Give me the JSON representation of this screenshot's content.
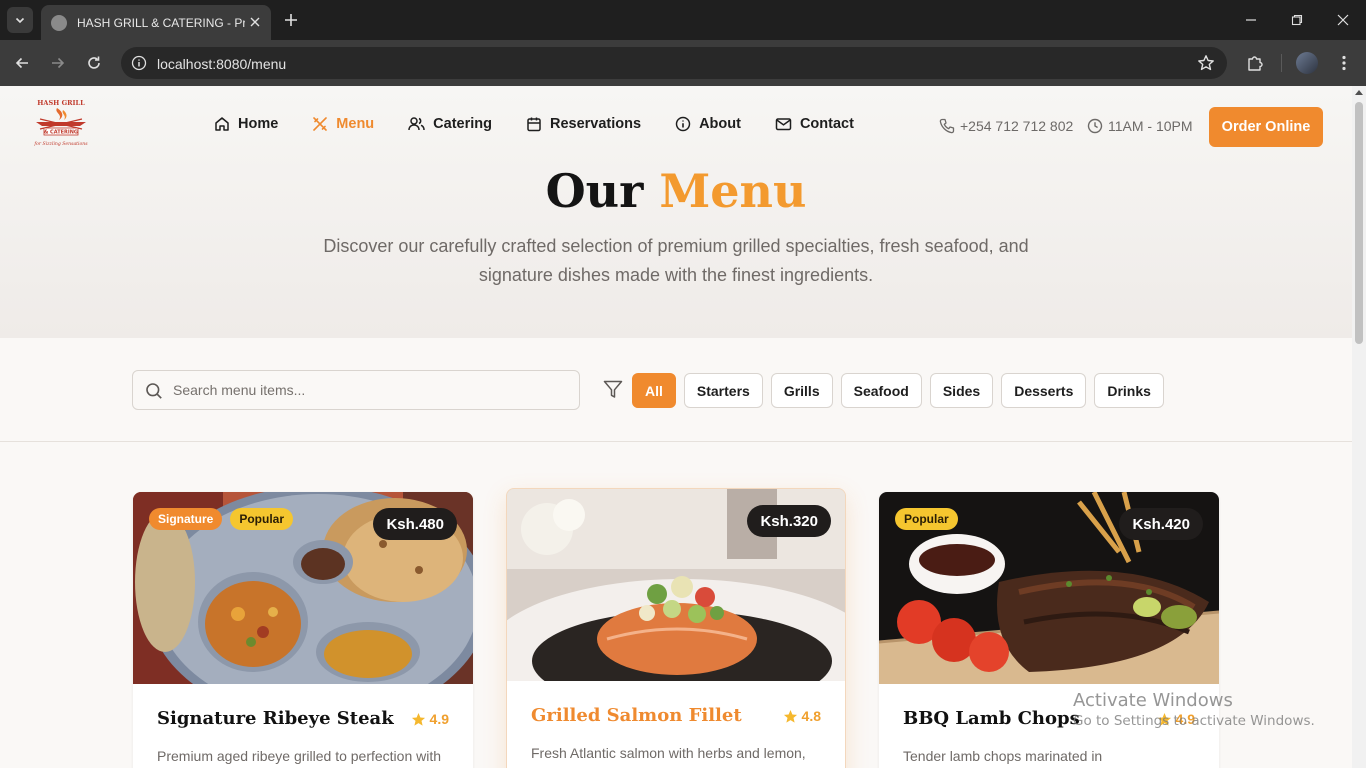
{
  "browser": {
    "tab_title": "HASH GRILL & CATERING - Premium Grill & Catering",
    "url": "localhost:8080/menu"
  },
  "header": {
    "logo_text": [
      "HASH GRILL",
      "& CATERING",
      "for Sizzling Sensations"
    ],
    "nav": [
      {
        "label": "Home",
        "icon": "home-icon"
      },
      {
        "label": "Menu",
        "icon": "utensils-icon",
        "active": true
      },
      {
        "label": "Catering",
        "icon": "users-icon"
      },
      {
        "label": "Reservations",
        "icon": "calendar-icon"
      },
      {
        "label": "About",
        "icon": "info-icon"
      },
      {
        "label": "Contact",
        "icon": "mail-icon"
      }
    ],
    "phone": "+254 712 712 802",
    "hours": "11AM - 10PM",
    "order_label": "Order Online"
  },
  "hero": {
    "title_plain": "Our",
    "title_accent": "Menu",
    "subtitle": "Discover our carefully crafted selection of premium grilled specialties, fresh seafood, and signature dishes made with the finest ingredients."
  },
  "filters": {
    "search_placeholder": "Search menu items...",
    "categories": [
      "All",
      "Starters",
      "Grills",
      "Seafood",
      "Sides",
      "Desserts",
      "Drinks"
    ],
    "active": "All"
  },
  "items": [
    {
      "name": "Signature Ribeye Steak",
      "price": "Ksh.480",
      "rating": "4.9",
      "badges": [
        "Signature",
        "Popular"
      ],
      "desc": "Premium aged ribeye grilled to perfection with"
    },
    {
      "name": "Grilled Salmon Fillet",
      "price": "Ksh.320",
      "rating": "4.8",
      "badges": [],
      "desc": "Fresh Atlantic salmon with herbs and lemon,"
    },
    {
      "name": "BBQ Lamb Chops",
      "price": "Ksh.420",
      "rating": "4.9",
      "badges": [
        "Popular"
      ],
      "desc": "Tender lamb chops marinated in"
    }
  ],
  "watermark": {
    "line1": "Activate Windows",
    "line2": "Go to Settings to activate Windows."
  },
  "colors": {
    "accent": "#f08a2e",
    "badge_popular": "#f5c62f",
    "price_pill": "#201d1c",
    "text_dark": "#141414",
    "text_muted": "#6f6a67"
  }
}
